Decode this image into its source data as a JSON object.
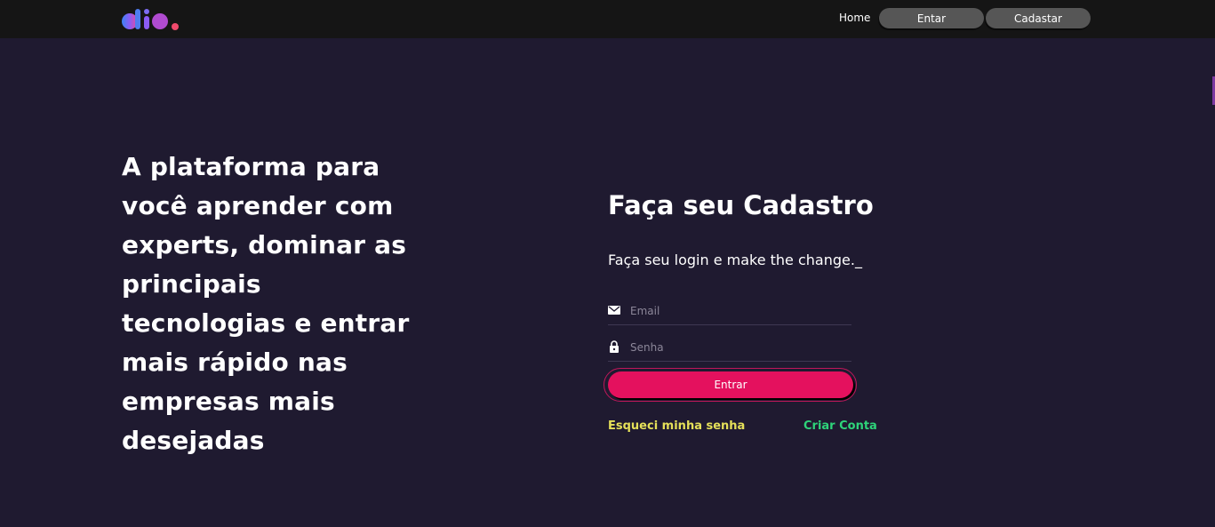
{
  "header": {
    "logo_text": "dio.",
    "nav": {
      "home_label": "Home",
      "enter_label": "Entar",
      "register_label": "Cadastar"
    }
  },
  "hero": {
    "headline": "A plataforma para você aprender com experts, dominar as principais tecnologias e entrar mais rápido nas empresas mais desejadas"
  },
  "form": {
    "title": "Faça seu Cadastro",
    "subtitle": "Faça seu login e make the change._",
    "email": {
      "value": "",
      "placeholder": "Email",
      "icon": "mail-icon"
    },
    "password": {
      "value": "",
      "placeholder": "Senha",
      "icon": "lock-icon"
    },
    "submit_label": "Entar",
    "submit_button_label": "Entrar",
    "forgot_label": "Esqueci minha senha",
    "create_label": "Criar Conta"
  },
  "colors": {
    "background": "#1f1a30",
    "topbar": "#151515",
    "nav_button": "#565656",
    "primary": "#e4115e",
    "forgot_link": "#e5e059",
    "create_link": "#2ed47a"
  }
}
